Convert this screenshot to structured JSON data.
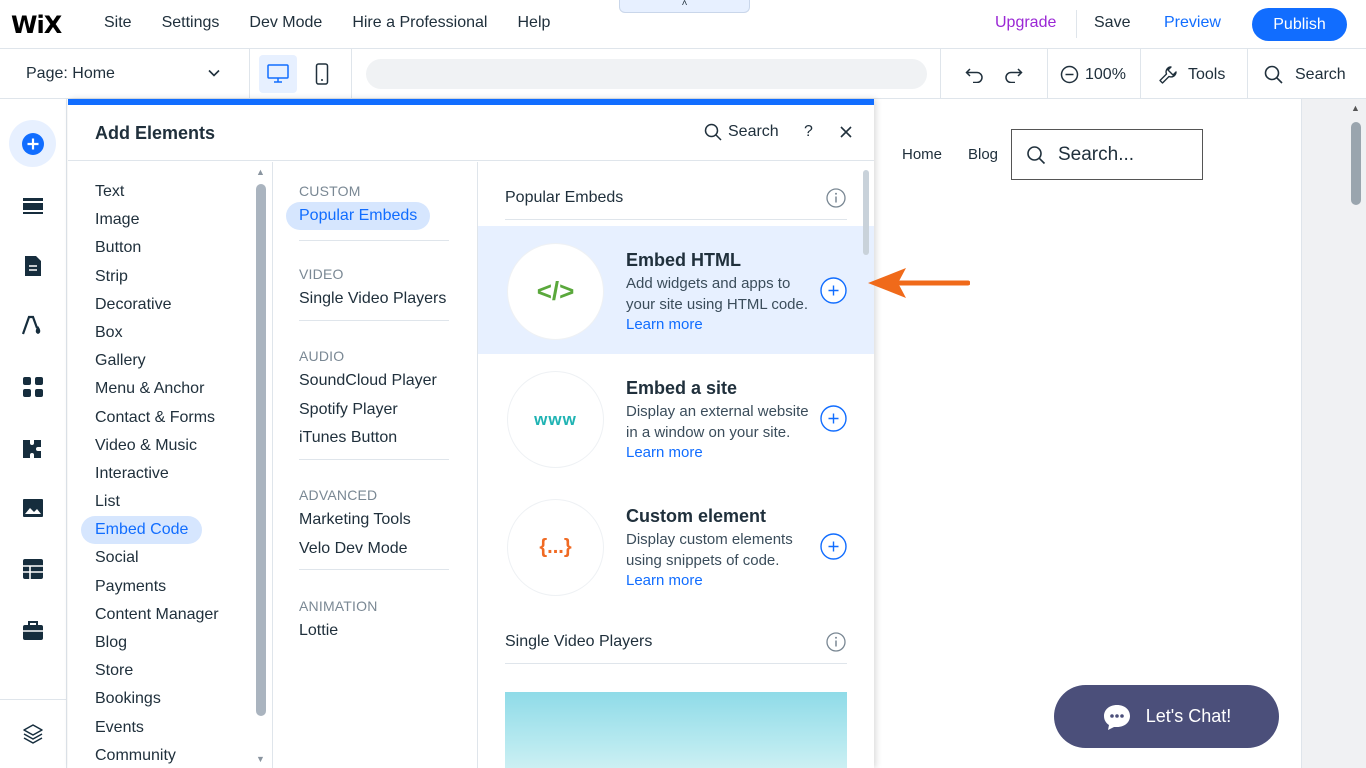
{
  "topbar": {
    "logo": "WiX",
    "menu": [
      "Site",
      "Settings",
      "Dev Mode",
      "Hire a Professional",
      "Help"
    ],
    "collapse_glyph": "˄",
    "upgrade": "Upgrade",
    "save": "Save",
    "preview": "Preview",
    "publish": "Publish"
  },
  "bar2": {
    "page_selector": "Page: Home",
    "zoom": "100%",
    "tools": "Tools",
    "search": "Search"
  },
  "panel": {
    "title": "Add Elements",
    "search": "Search",
    "help": "?",
    "categories": [
      "Text",
      "Image",
      "Button",
      "Strip",
      "Decorative",
      "Box",
      "Gallery",
      "Menu & Anchor",
      "Contact & Forms",
      "Video & Music",
      "Interactive",
      "List",
      "Embed Code",
      "Social",
      "Payments",
      "Content Manager",
      "Blog",
      "Store",
      "Bookings",
      "Events",
      "Community"
    ],
    "active_category": "Embed Code",
    "subgroups": [
      {
        "heading": "CUSTOM",
        "items": [
          "Popular Embeds"
        ]
      },
      {
        "heading": "VIDEO",
        "items": [
          "Single Video Players"
        ]
      },
      {
        "heading": "AUDIO",
        "items": [
          "SoundCloud Player",
          "Spotify Player",
          "iTunes Button"
        ]
      },
      {
        "heading": "ADVANCED",
        "items": [
          "Marketing Tools",
          "Velo Dev Mode"
        ]
      },
      {
        "heading": "ANIMATION",
        "items": [
          "Lottie"
        ]
      }
    ],
    "sections": [
      {
        "title": "Popular Embeds"
      },
      {
        "title": "Single Video Players"
      }
    ],
    "cards": [
      {
        "icon_text": "</>",
        "icon_color": "#5aa83c",
        "title": "Embed HTML",
        "desc": "Add widgets and apps to your site using HTML code.",
        "learn_more": "Learn more"
      },
      {
        "icon_text": "www",
        "icon_color": "#1fb3b3",
        "title": "Embed a site",
        "desc": "Display an external website in a window on your site.",
        "learn_more": "Learn more"
      },
      {
        "icon_text": "{...}",
        "icon_color": "#f06a23",
        "title": "Custom element",
        "desc": "Display custom elements using snippets of code.",
        "learn_more": "Learn more"
      }
    ]
  },
  "canvas": {
    "nav": [
      "Home",
      "Blog"
    ],
    "search_placeholder": "Search...",
    "chat": "Let's Chat!"
  },
  "colors": {
    "accent": "#116dff",
    "upgrade": "#9a27d5",
    "arrow": "#f06a1a",
    "chat_bg": "#4b4f7a"
  }
}
